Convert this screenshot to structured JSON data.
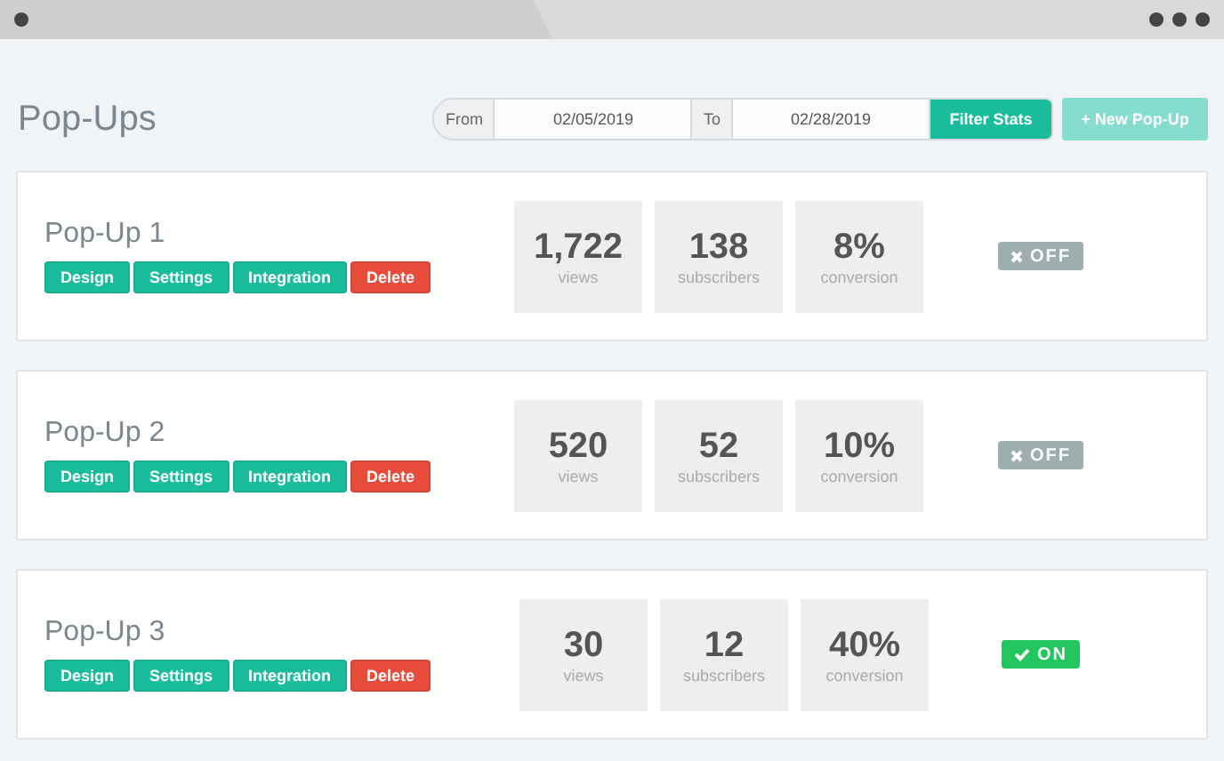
{
  "page_title": "Pop-Ups",
  "filter": {
    "from_label": "From",
    "from_value": "02/05/2019",
    "to_label": "To",
    "to_value": "02/28/2019",
    "button": "Filter Stats"
  },
  "new_button": "+ New Pop-Up",
  "popups": [
    {
      "name": "Pop-Up 1",
      "actions": [
        {
          "label": "Design",
          "kind": "normal"
        },
        {
          "label": "Settings",
          "kind": "normal"
        },
        {
          "label": "Integration",
          "kind": "normal"
        },
        {
          "label": "Delete",
          "kind": "danger"
        }
      ],
      "stats": [
        {
          "value": "1,722",
          "label": "views"
        },
        {
          "value": "138",
          "label": "subscribers"
        },
        {
          "value": "8%",
          "label": "conversion"
        }
      ],
      "status": {
        "on": false,
        "label": "OFF"
      }
    },
    {
      "name": "Pop-Up 2",
      "actions": [
        {
          "label": "Design",
          "kind": "normal"
        },
        {
          "label": "Settings",
          "kind": "normal"
        },
        {
          "label": "Integration",
          "kind": "normal"
        },
        {
          "label": "Delete",
          "kind": "danger"
        }
      ],
      "stats": [
        {
          "value": "520",
          "label": "views"
        },
        {
          "value": "52",
          "label": "subscribers"
        },
        {
          "value": "10%",
          "label": "conversion"
        }
      ],
      "status": {
        "on": false,
        "label": "OFF"
      }
    },
    {
      "name": "Pop-Up 3",
      "actions": [
        {
          "label": "Design",
          "kind": "normal"
        },
        {
          "label": "Settings",
          "kind": "normal"
        },
        {
          "label": "Integration",
          "kind": "normal"
        },
        {
          "label": "Delete",
          "kind": "danger"
        }
      ],
      "stats": [
        {
          "value": "30",
          "label": "views"
        },
        {
          "value": "12",
          "label": "subscribers"
        },
        {
          "value": "40%",
          "label": "conversion"
        }
      ],
      "status": {
        "on": true,
        "label": "ON"
      }
    }
  ]
}
